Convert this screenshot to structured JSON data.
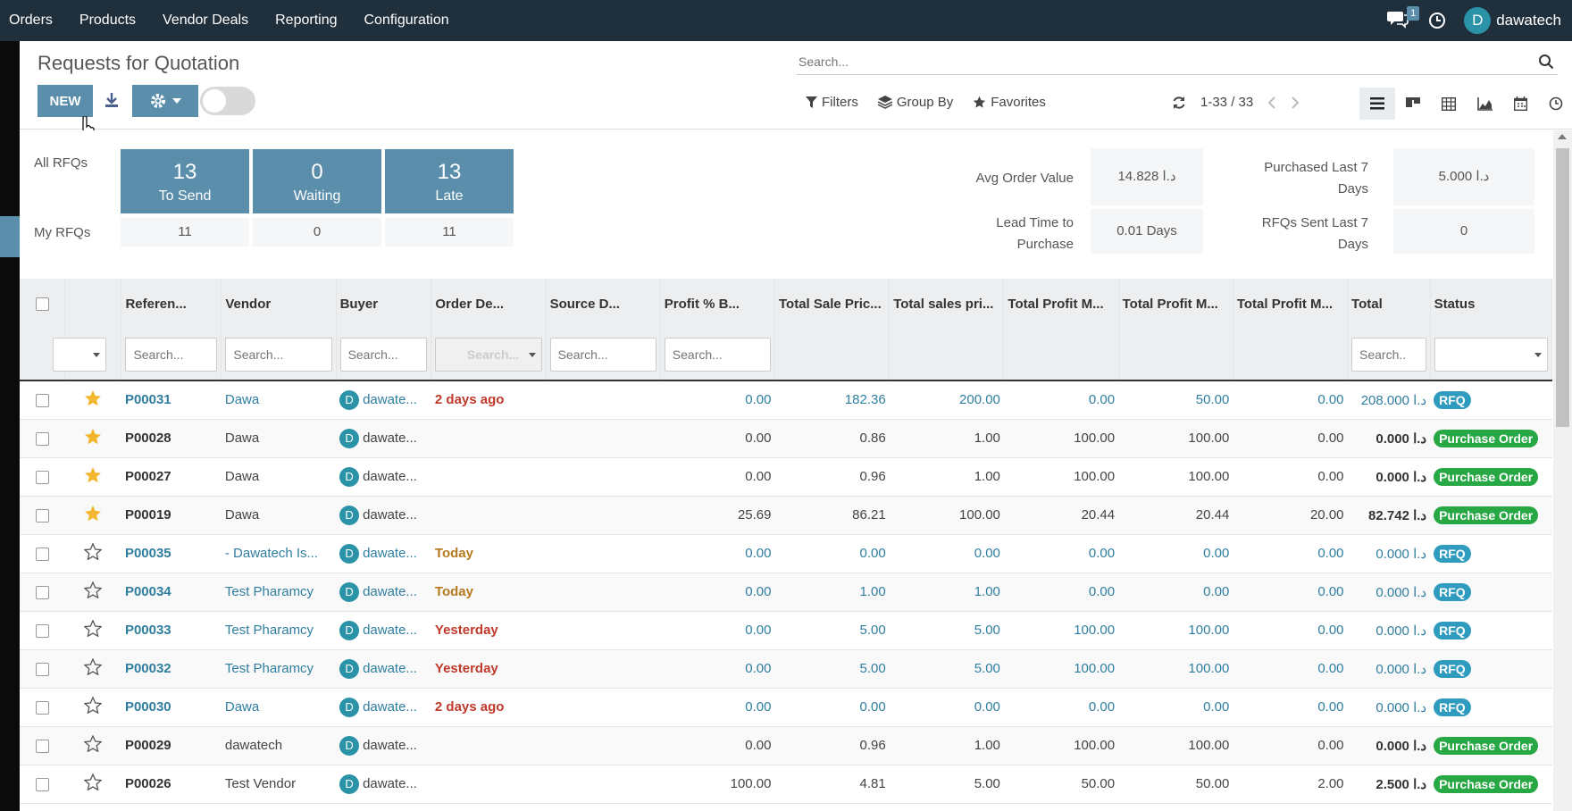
{
  "topnav": {
    "items": [
      "Orders",
      "Products",
      "Vendor Deals",
      "Reporting",
      "Configuration"
    ],
    "chat_count": "1",
    "user_initial": "D",
    "user_name": "dawatech"
  },
  "control": {
    "title": "Requests for Quotation",
    "new_label": "NEW",
    "search_placeholder": "Search...",
    "filters_label": "Filters",
    "groupby_label": "Group By",
    "favorites_label": "Favorites",
    "pager": "1-33 / 33"
  },
  "dashboard": {
    "all_label": "All RFQs",
    "my_label": "My RFQs",
    "tiles": [
      {
        "num": "13",
        "cap": "To Send"
      },
      {
        "num": "0",
        "cap": "Waiting"
      },
      {
        "num": "13",
        "cap": "Late"
      }
    ],
    "my": [
      "11",
      "0",
      "11"
    ],
    "kpis": {
      "avg_order_label": "Avg Order Value",
      "avg_order_value": "14.828  د.ا",
      "lead_time_label": "Lead Time to Purchase",
      "lead_time_value": "0.01 Days",
      "purchased_label": "Purchased Last 7 Days",
      "purchased_value": "5.000  د.ا",
      "rfqs_sent_label": "RFQs Sent Last 7 Days",
      "rfqs_sent_value": "0"
    }
  },
  "table": {
    "headers": [
      "Referen...",
      "Vendor",
      "Buyer",
      "Order De...",
      "Source D...",
      "Profit % B...",
      "Total Sale Pric...",
      "Total sales pri...",
      "Total Profit M...",
      "Total Profit M...",
      "Total Profit M...",
      "Total",
      "Status"
    ],
    "filter_placeholder": "Search...",
    "filter_placeholder_total": "Search..",
    "rows": [
      {
        "starred": true,
        "ref": "P00031",
        "vendor": "Dawa",
        "buyer": "dawate...",
        "deadline": "2 days ago",
        "dl": "red",
        "p1": "0.00",
        "p2": "182.36",
        "p3": "200.00",
        "p4": "0.00",
        "p5": "50.00",
        "p6": "0.00",
        "total": "208.000  د.ا",
        "status": "RFQ"
      },
      {
        "starred": true,
        "ref": "P00028",
        "vendor": "Dawa",
        "buyer": "dawate...",
        "deadline": "",
        "dl": "",
        "p1": "0.00",
        "p2": "0.86",
        "p3": "1.00",
        "p4": "100.00",
        "p5": "100.00",
        "p6": "0.00",
        "total": "0.000  د.ا",
        "status": "Purchase Order"
      },
      {
        "starred": true,
        "ref": "P00027",
        "vendor": "Dawa",
        "buyer": "dawate...",
        "deadline": "",
        "dl": "",
        "p1": "0.00",
        "p2": "0.96",
        "p3": "1.00",
        "p4": "100.00",
        "p5": "100.00",
        "p6": "0.00",
        "total": "0.000  د.ا",
        "status": "Purchase Order"
      },
      {
        "starred": true,
        "ref": "P00019",
        "vendor": "Dawa",
        "buyer": "dawate...",
        "deadline": "",
        "dl": "",
        "p1": "25.69",
        "p2": "86.21",
        "p3": "100.00",
        "p4": "20.44",
        "p5": "20.44",
        "p6": "20.00",
        "total": "82.742  د.ا",
        "status": "Purchase Order"
      },
      {
        "starred": false,
        "ref": "P00035",
        "vendor": "- Dawatech Is...",
        "buyer": "dawate...",
        "deadline": "Today",
        "dl": "amber",
        "p1": "0.00",
        "p2": "0.00",
        "p3": "0.00",
        "p4": "0.00",
        "p5": "0.00",
        "p6": "0.00",
        "total": "0.000  د.ا",
        "status": "RFQ"
      },
      {
        "starred": false,
        "ref": "P00034",
        "vendor": "Test Pharamcy",
        "buyer": "dawate...",
        "deadline": "Today",
        "dl": "amber",
        "p1": "0.00",
        "p2": "1.00",
        "p3": "1.00",
        "p4": "0.00",
        "p5": "0.00",
        "p6": "0.00",
        "total": "0.000  د.ا",
        "status": "RFQ"
      },
      {
        "starred": false,
        "ref": "P00033",
        "vendor": "Test Pharamcy",
        "buyer": "dawate...",
        "deadline": "Yesterday",
        "dl": "red",
        "p1": "0.00",
        "p2": "5.00",
        "p3": "5.00",
        "p4": "100.00",
        "p5": "100.00",
        "p6": "0.00",
        "total": "0.000  د.ا",
        "status": "RFQ"
      },
      {
        "starred": false,
        "ref": "P00032",
        "vendor": "Test Pharamcy",
        "buyer": "dawate...",
        "deadline": "Yesterday",
        "dl": "red",
        "p1": "0.00",
        "p2": "5.00",
        "p3": "5.00",
        "p4": "100.00",
        "p5": "100.00",
        "p6": "0.00",
        "total": "0.000  د.ا",
        "status": "RFQ"
      },
      {
        "starred": false,
        "ref": "P00030",
        "vendor": "Dawa",
        "buyer": "dawate...",
        "deadline": "2 days ago",
        "dl": "red",
        "p1": "0.00",
        "p2": "0.00",
        "p3": "0.00",
        "p4": "0.00",
        "p5": "0.00",
        "p6": "0.00",
        "total": "0.000  د.ا",
        "status": "RFQ"
      },
      {
        "starred": false,
        "ref": "P00029",
        "vendor": "dawatech",
        "buyer": "dawate...",
        "deadline": "",
        "dl": "",
        "p1": "0.00",
        "p2": "0.96",
        "p3": "1.00",
        "p4": "100.00",
        "p5": "100.00",
        "p6": "0.00",
        "total": "0.000  د.ا",
        "status": "Purchase Order"
      },
      {
        "starred": false,
        "ref": "P00026",
        "vendor": "Test Vendor",
        "buyer": "dawate...",
        "deadline": "",
        "dl": "",
        "p1": "100.00",
        "p2": "4.81",
        "p3": "5.00",
        "p4": "50.00",
        "p5": "50.00",
        "p6": "2.00",
        "total": "2.500  د.ا",
        "status": "Purchase Order"
      }
    ]
  },
  "colors": {
    "topbar": "#1f2f3c",
    "accent": "#5a8eab",
    "link": "#2f7ea0",
    "rfq_badge": "#2f9bbf",
    "po_badge": "#28a745",
    "star": "#f3b631"
  }
}
